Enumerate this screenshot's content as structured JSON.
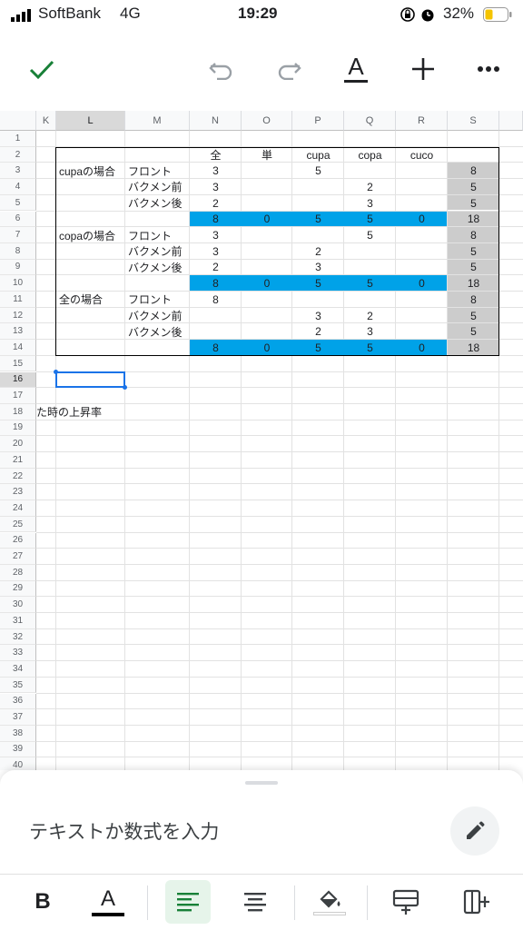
{
  "status": {
    "carrier": "SoftBank",
    "network": "4G",
    "time": "19:29",
    "battery": "32%"
  },
  "toolbar": {
    "text_color_glyph": "A"
  },
  "columns": [
    "K",
    "L",
    "M",
    "N",
    "O",
    "P",
    "Q",
    "R",
    "S"
  ],
  "rows": [
    "1",
    "2",
    "3",
    "4",
    "5",
    "6",
    "7",
    "8",
    "9",
    "10",
    "11",
    "12",
    "13",
    "14",
    "15",
    "16",
    "17",
    "18",
    "19",
    "20",
    "21",
    "22",
    "23",
    "24",
    "25",
    "26",
    "27",
    "28",
    "29",
    "30",
    "31",
    "32",
    "33",
    "34",
    "35",
    "36",
    "37",
    "38",
    "39",
    "40"
  ],
  "table": {
    "header": [
      "全",
      "単",
      "cupa",
      "copa",
      "cuco"
    ],
    "rows": [
      {
        "label": "cupaの場合",
        "pos": "フロント",
        "vals": [
          "3",
          "",
          "5",
          "",
          ""
        ],
        "total": "8"
      },
      {
        "label": "",
        "pos": "バクメン前",
        "vals": [
          "3",
          "",
          "",
          "2",
          ""
        ],
        "total": "5"
      },
      {
        "label": "",
        "pos": "バクメン後",
        "vals": [
          "2",
          "",
          "",
          "3",
          ""
        ],
        "total": "5"
      },
      {
        "label": "",
        "pos": "",
        "vals": [
          "8",
          "0",
          "5",
          "5",
          "0"
        ],
        "total": "18",
        "sum": true
      },
      {
        "label": "copaの場合",
        "pos": "フロント",
        "vals": [
          "3",
          "",
          "",
          "5",
          ""
        ],
        "total": "8"
      },
      {
        "label": "",
        "pos": "バクメン前",
        "vals": [
          "3",
          "",
          "2",
          "",
          ""
        ],
        "total": "5"
      },
      {
        "label": "",
        "pos": "バクメン後",
        "vals": [
          "2",
          "",
          "3",
          "",
          ""
        ],
        "total": "5"
      },
      {
        "label": "",
        "pos": "",
        "vals": [
          "8",
          "0",
          "5",
          "5",
          "0"
        ],
        "total": "18",
        "sum": true
      },
      {
        "label": "全の場合",
        "pos": "フロント",
        "vals": [
          "8",
          "",
          "",
          "",
          ""
        ],
        "total": "8"
      },
      {
        "label": "",
        "pos": "バクメン前",
        "vals": [
          "",
          "",
          "3",
          "2",
          ""
        ],
        "total": "5"
      },
      {
        "label": "",
        "pos": "バクメン後",
        "vals": [
          "",
          "",
          "2",
          "3",
          ""
        ],
        "total": "5"
      },
      {
        "label": "",
        "pos": "",
        "vals": [
          "8",
          "0",
          "5",
          "5",
          "0"
        ],
        "total": "18",
        "sum": true
      }
    ]
  },
  "overflow_text": "た時の上昇率",
  "input": {
    "placeholder": "テキストか数式を入力"
  },
  "format": {
    "bold": "B",
    "text_color": "A"
  },
  "colors": {
    "sum_fill": "#00a2e8",
    "total_fill": "#cccccc",
    "accent": "#1a73e8",
    "check": "#188038"
  }
}
